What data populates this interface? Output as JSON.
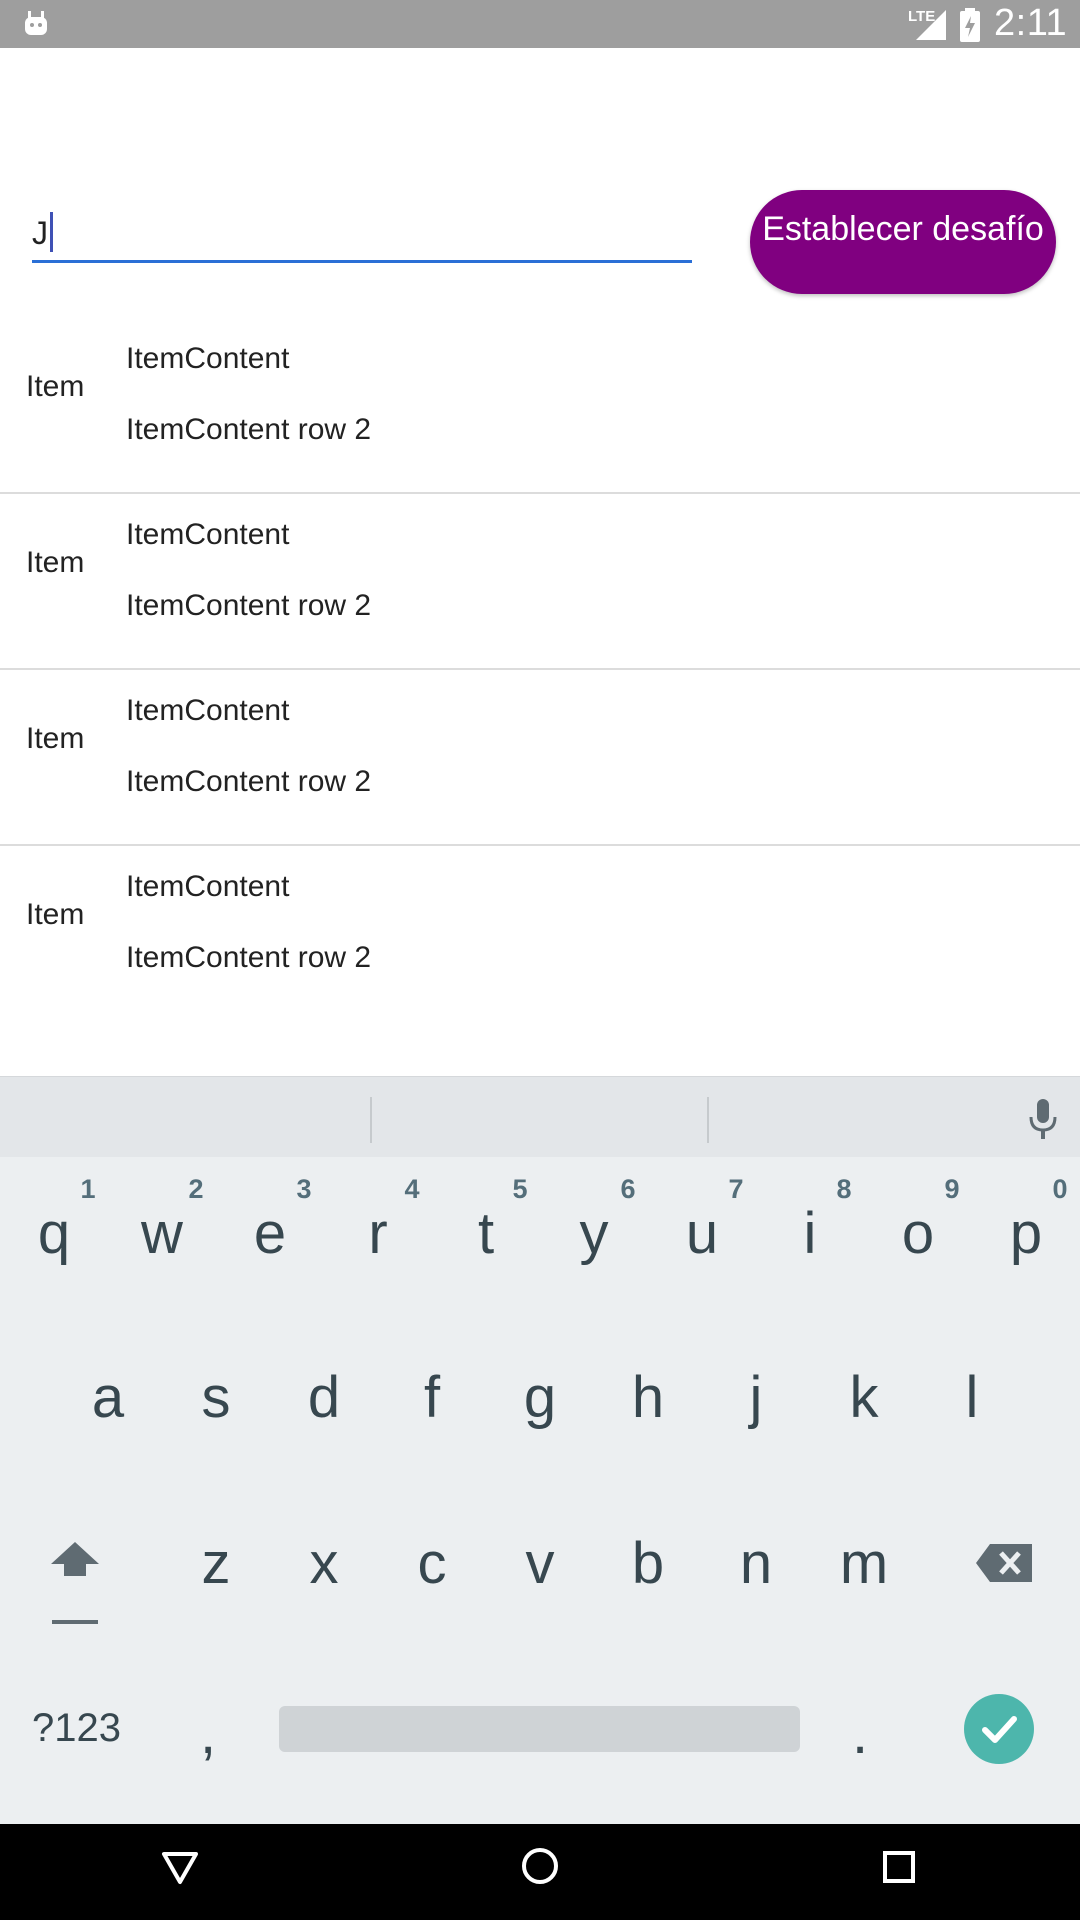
{
  "status_bar": {
    "network": "LTE",
    "time": "2:11",
    "icons": [
      "android-debug-icon",
      "lte-signal-icon",
      "battery-charging-icon"
    ]
  },
  "input": {
    "value": "J"
  },
  "action_button": {
    "label": "Establecer desafío",
    "color": "#800080"
  },
  "list": {
    "items": [
      {
        "label": "Item",
        "content": "ItemContent",
        "content2": "ItemContent row 2"
      },
      {
        "label": "Item",
        "content": "ItemContent",
        "content2": "ItemContent row 2"
      },
      {
        "label": "Item",
        "content": "ItemContent",
        "content2": "ItemContent row 2"
      },
      {
        "label": "Item",
        "content": "ItemContent",
        "content2": "ItemContent row 2"
      }
    ]
  },
  "keyboard": {
    "row1": [
      "q",
      "w",
      "e",
      "r",
      "t",
      "y",
      "u",
      "i",
      "o",
      "p"
    ],
    "row1_hints": [
      "1",
      "2",
      "3",
      "4",
      "5",
      "6",
      "7",
      "8",
      "9",
      "0"
    ],
    "row2": [
      "a",
      "s",
      "d",
      "f",
      "g",
      "h",
      "j",
      "k",
      "l"
    ],
    "row3": [
      "z",
      "x",
      "c",
      "v",
      "b",
      "n",
      "m"
    ],
    "symbols_label": "?123",
    "comma": ",",
    "period": ".",
    "enter_color": "#4db6ac"
  },
  "nav_bar": {
    "icons": [
      "back-icon",
      "home-icon",
      "recents-icon"
    ]
  }
}
